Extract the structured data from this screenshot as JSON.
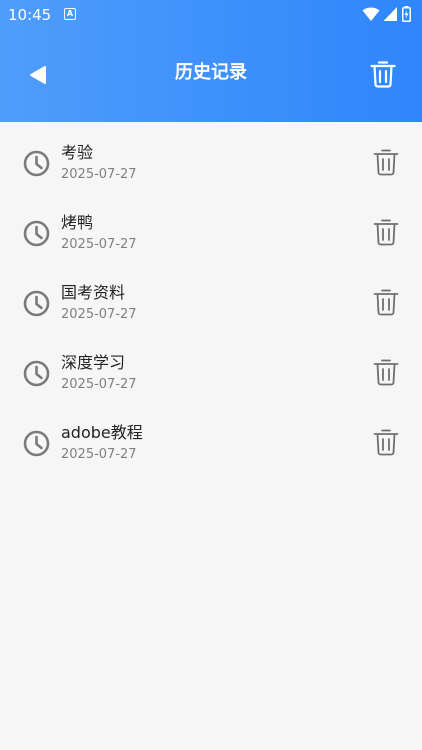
{
  "status_bar": {
    "time": "10:45",
    "notification_icon": "a-notification-icon",
    "wifi_icon": "wifi-icon",
    "signal_icon": "cell-signal-icon",
    "battery_icon": "battery-icon"
  },
  "header": {
    "title": "历史记录",
    "back_icon": "back-arrow-icon",
    "clear_icon": "trash-icon"
  },
  "history": [
    {
      "title": "考验",
      "date": "2025-07-27"
    },
    {
      "title": "烤鸭",
      "date": "2025-07-27"
    },
    {
      "title": "国考资料",
      "date": "2025-07-27"
    },
    {
      "title": "深度学习",
      "date": "2025-07-27"
    },
    {
      "title": "adobe教程",
      "date": "2025-07-27"
    }
  ],
  "colors": {
    "header_start": "#4f9dfb",
    "header_end": "#2f86fb",
    "background": "#f6f6f6",
    "icon_gray": "#7a7a7a"
  }
}
